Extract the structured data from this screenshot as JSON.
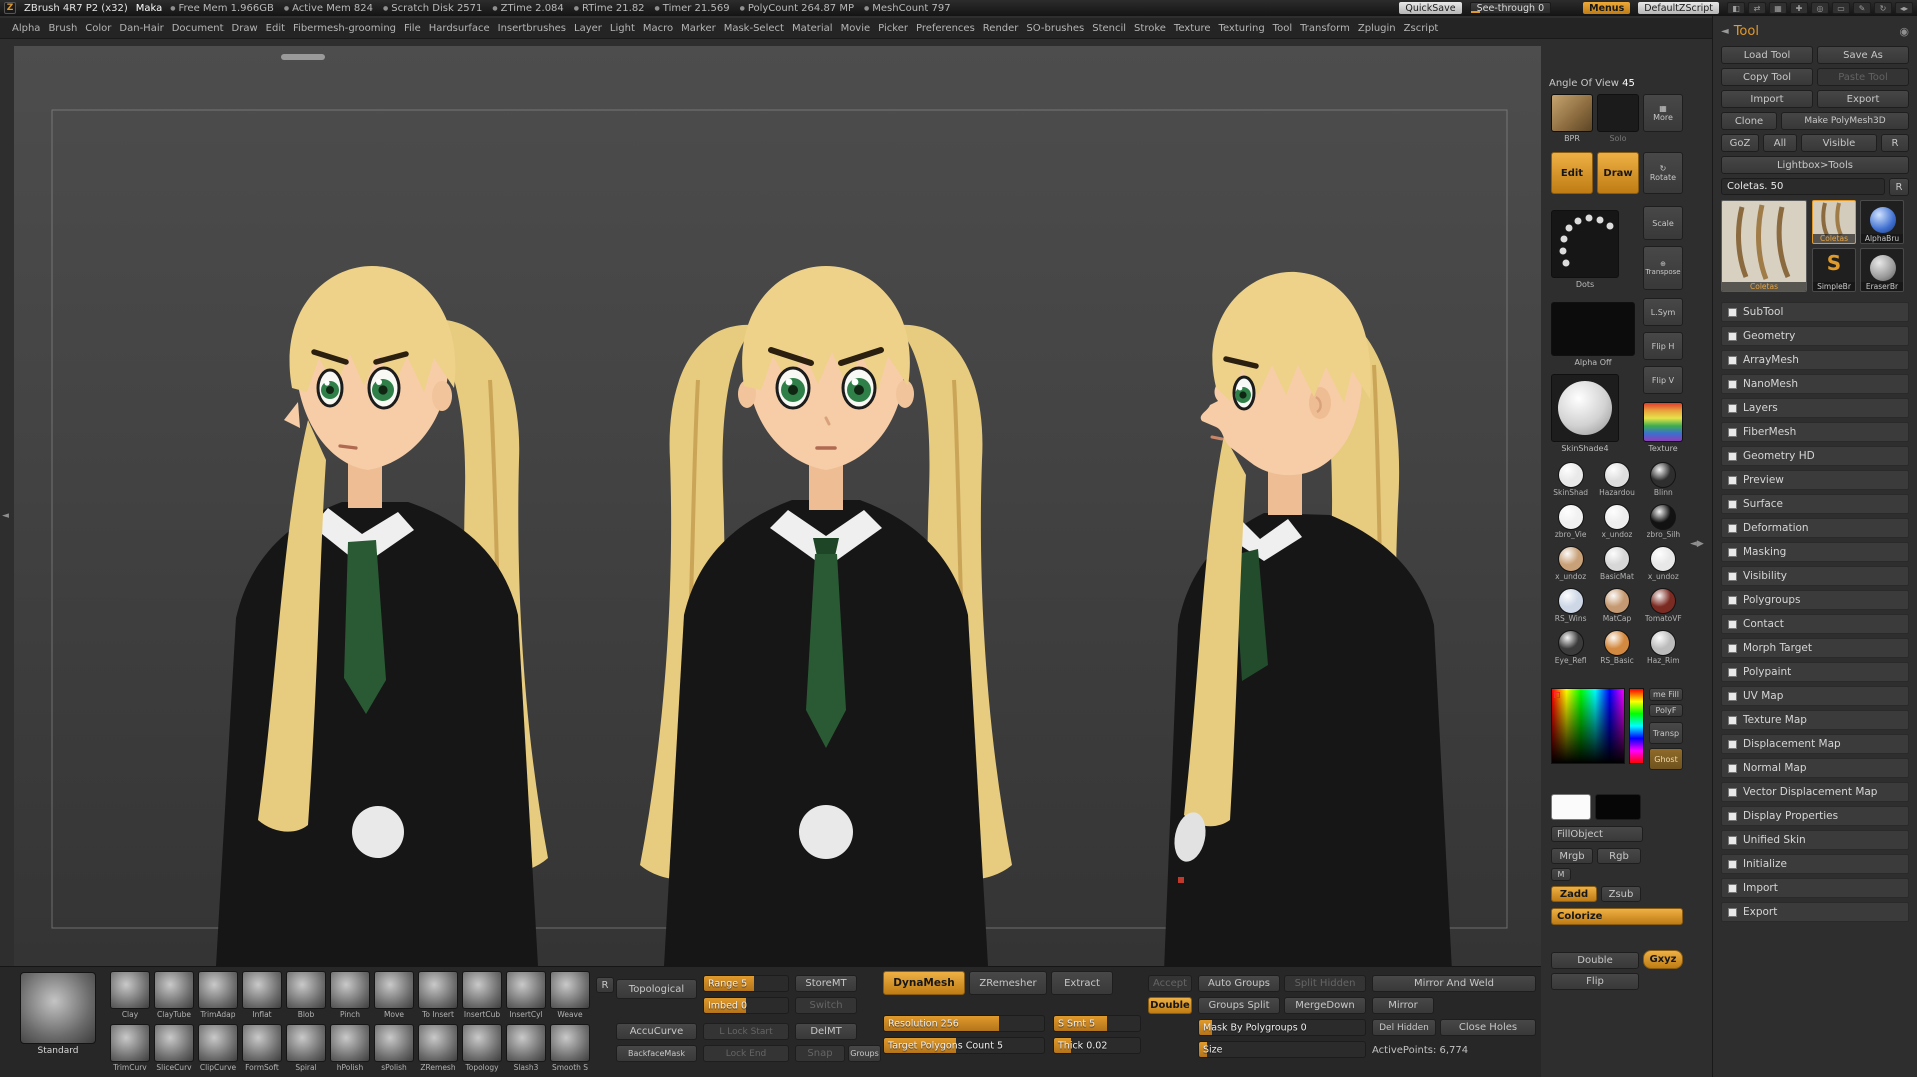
{
  "titlebar": {
    "app_title": "ZBrush 4R7 P2 (x32)",
    "document_name": "Maka",
    "stats": [
      "Free Mem 1.966GB",
      "Active Mem 824",
      "Scratch Disk 2571",
      "ZTime 2.084",
      "RTime 21.82",
      "Timer 21.569",
      "PolyCount 264.87 MP",
      "MeshCount 797"
    ],
    "quicksave_label": "QuickSave",
    "seethrough_label": "See-through 0",
    "seethrough_fill": 0.12,
    "menus_label": "Menus",
    "defaultzscript_label": "DefaultZScript",
    "icons": [
      "◧",
      "⇄",
      "▦",
      "✚",
      "◎",
      "▭",
      "✎",
      "↻",
      "◂▸"
    ]
  },
  "menubar": [
    "Alpha",
    "Brush",
    "Color",
    "Dan-Hair",
    "Document",
    "Draw",
    "Edit",
    "Fibermesh-grooming",
    "File",
    "Hardsurface",
    "Insertbrushes",
    "Layer",
    "Light",
    "Macro",
    "Marker",
    "Mask-Select",
    "Material",
    "Movie",
    "Picker",
    "Preferences",
    "Render",
    "SO-brushes",
    "Stencil",
    "Stroke",
    "Texture",
    "Texturing",
    "Tool",
    "Transform",
    "Zplugin",
    "Zscript"
  ],
  "shelf": {
    "angle_of_view_label": "Angle Of View",
    "angle_of_view_value": "45",
    "bpr_label": "BPR",
    "solo_label": "Solo",
    "edit_label": "Edit",
    "draw_label": "Draw",
    "stroke_label": "Dots",
    "alpha_label": "Alpha Off",
    "material_label": "SkinShade4",
    "texture_label": "Texture",
    "side_buttons": [
      "More",
      "Rotate",
      "Scale",
      "Transpose",
      "L.Sym",
      "Flip H",
      "Flip V"
    ],
    "material_swatches": [
      {
        "name": "SkinShad",
        "color": "#e9e9e9"
      },
      {
        "name": "Hazardou",
        "color": "#dedede"
      },
      {
        "name": "Blinn",
        "color": "#2e2e2e"
      },
      {
        "name": "zbro_Vie",
        "color": "#f1f1f1"
      },
      {
        "name": "x_undoz",
        "color": "#ededed"
      },
      {
        "name": "zbro_Silh",
        "color": "#121212"
      },
      {
        "name": "x_undoz",
        "color": "#c9a179"
      },
      {
        "name": "BasicMat",
        "color": "#d7d7d7"
      },
      {
        "name": "x_undoz",
        "color": "#e8e8e8"
      },
      {
        "name": "RS_Wins",
        "color": "#cdd7e6"
      },
      {
        "name": "MatCap",
        "color": "#c59a72"
      },
      {
        "name": "TomatoVF",
        "color": "#7c2b22"
      },
      {
        "name": "Eye_Refl",
        "color": "#3b3b3b"
      },
      {
        "name": "RS_Basic",
        "color": "#d3893f"
      },
      {
        "name": "Haz_Rim",
        "color": "#bcbcbc"
      }
    ],
    "small_buttons": [
      "me Fill",
      "PolyF",
      "Transp",
      "Ghost"
    ],
    "fillobject_label": "FillObject",
    "mrgb_label": "Mrgb",
    "rgb_label": "Rgb",
    "m_label": "M",
    "zadd_label": "Zadd",
    "zsub_label": "Zsub",
    "colorize_label": "Colorize",
    "double_label": "Double",
    "gxyz_label": "Gxyz",
    "flip_label": "Flip"
  },
  "tool_panel": {
    "title": "Tool",
    "load_label": "Load Tool",
    "saveas_label": "Save As",
    "copy_label": "Copy Tool",
    "paste_label": "Paste Tool",
    "import_label": "Import",
    "export_label": "Export",
    "clone_label": "Clone",
    "makepoly_label": "Make PolyMesh3D",
    "goz_label": "GoZ",
    "all_label": "All",
    "visible_label": "Visible",
    "r_label": "R",
    "lightbox_label": "Lightbox>Tools",
    "current_tool_label": "Coletas. 50",
    "thumbnails": [
      {
        "name": "Coletas"
      },
      {
        "name": "Coletas"
      },
      {
        "name": "AlphaBru"
      },
      {
        "name": "SimpleBr"
      },
      {
        "name": "EraserBr"
      }
    ],
    "sections": [
      "SubTool",
      "Geometry",
      "ArrayMesh",
      "NanoMesh",
      "Layers",
      "FiberMesh",
      "Geometry HD",
      "Preview",
      "Surface",
      "Deformation",
      "Masking",
      "Visibility",
      "Polygroups",
      "Contact",
      "Morph Target",
      "Polypaint",
      "UV Map",
      "Texture Map",
      "Displacement Map",
      "Normal Map",
      "Vector Displacement Map",
      "Display Properties",
      "Unified Skin",
      "Initialize",
      "Import",
      "Export"
    ]
  },
  "brush_tray": {
    "active_brush": "Standard",
    "rows": [
      [
        "Clay",
        "ClayTube",
        "TrimAdap",
        "Inflat",
        "Blob",
        "Pinch",
        "Move",
        "To Insert",
        "InsertCub",
        "InsertCyl",
        "Weave"
      ],
      [
        "TrimCurv",
        "SliceCurv",
        "ClipCurve",
        "FormSoft",
        "Spiral",
        "hPolish",
        "sPolish",
        "ZRemesh",
        "Topology",
        "Slash3",
        "Smooth S"
      ]
    ]
  },
  "bottom_controls": {
    "r_label": "R",
    "topological_label": "Topological",
    "accucurve_label": "AccuCurve",
    "backfacemask_label": "BackfaceMask",
    "range_label": "Range 5",
    "imbed_label": "Imbed 0",
    "lockstart_label": "L Lock Start",
    "lockend_label": "Lock End",
    "storemt_label": "StoreMT",
    "switch_label": "Switch",
    "delmt_label": "DelMT",
    "snap_label": "Snap",
    "groups_label": "Groups",
    "dynamesh_label": "DynaMesh",
    "zremesher_label": "ZRemesher",
    "extract_label": "Extract",
    "resolution_label": "Resolution 256",
    "target_label": "Target Polygons Count 5",
    "ssmt_label": "S Smt 5",
    "thick_label": "Thick 0.02",
    "accept_label": "Accept",
    "double_label": "Double",
    "autogroups_label": "Auto Groups",
    "groupssplit_label": "Groups Split",
    "splithidden_label": "Split Hidden",
    "mergedown_label": "MergeDown",
    "mask_label": "Mask By Polygroups 0",
    "size_label": "Size",
    "mirrorweld_label": "Mirror And Weld",
    "mirror_label": "Mirror",
    "delhidden_label": "Del Hidden",
    "closeholes_label": "Close Holes",
    "activepoints_label": "ActivePoints: 6,774",
    "fills": {
      "range": 0.6,
      "imbed": 0.5,
      "resolution": 0.72,
      "target": 0.45,
      "s_smt": 0.62,
      "thick": 0.2,
      "mask": 0.08,
      "size": 0.05
    }
  },
  "canvas": {
    "model_colors": {
      "hair": "#e7cb7e",
      "skin": "#f6cda6",
      "outfit": "#161616",
      "tie": "#2a5a34",
      "eyes": "#2f8048",
      "collar": "#efefef"
    }
  }
}
